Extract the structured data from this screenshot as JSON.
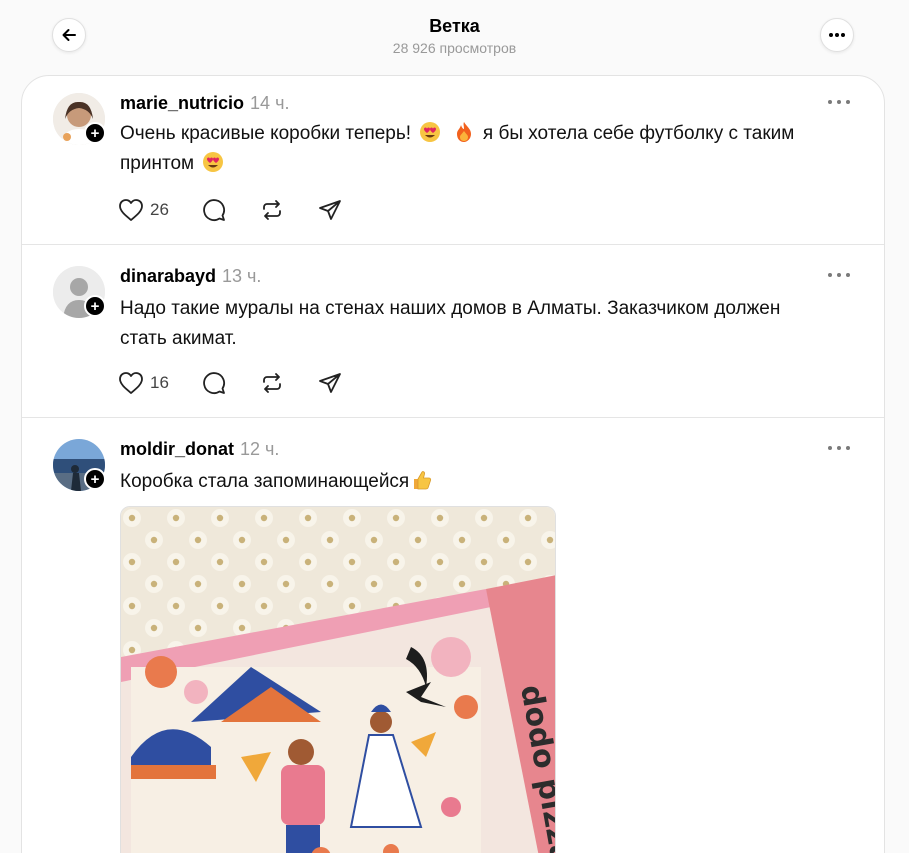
{
  "header": {
    "title": "Ветка",
    "views": "28 926 просмотров"
  },
  "posts": [
    {
      "username": "marie_nutricio",
      "time": "14 ч.",
      "text_part1": "Очень красивые коробки теперь!",
      "text_part2": "я бы хотела себе футболку с таким",
      "text_part3": "принтом",
      "likes": "26",
      "emojis": [
        "heart-eyes-emoji",
        "fire-emoji",
        "heart-eyes-emoji"
      ]
    },
    {
      "username": "dinarabayd",
      "time": "13 ч.",
      "text": "Надо такие муралы на стенах наших домов в Алматы. Заказчиком должен стать акимат.",
      "likes": "16"
    },
    {
      "username": "moldir_donat",
      "time": "12 ч.",
      "text": "Коробка стала запоминающейся",
      "emojis": [
        "thumbs-up-emoji"
      ]
    }
  ],
  "icons": {
    "back": "arrow-left-icon",
    "more": "more-horizontal-icon",
    "like": "heart-icon",
    "comment": "comment-icon",
    "repost": "repost-icon",
    "share": "share-icon",
    "follow": "plus-icon"
  },
  "colors": {
    "background": "#fafafa",
    "card": "#ffffff",
    "muted": "#999999",
    "text": "#000000"
  }
}
